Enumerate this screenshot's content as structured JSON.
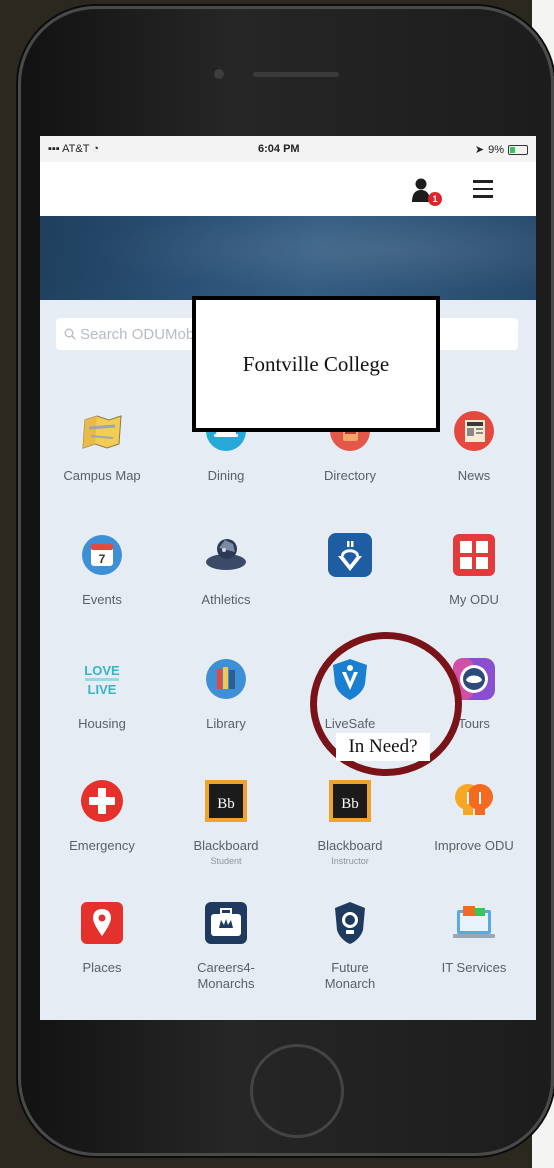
{
  "status_bar": {
    "carrier": "AT&T",
    "time": "6:04 PM",
    "battery": "9%"
  },
  "header": {
    "notification_count": "1",
    "college_name": "Fontville College"
  },
  "search": {
    "placeholder": "Search ODUMobile"
  },
  "grid": [
    {
      "label": "Campus Map",
      "icon": "map-icon"
    },
    {
      "label": "Dining",
      "icon": "dining-icon"
    },
    {
      "label": "Directory",
      "icon": "directory-icon"
    },
    {
      "label": "News",
      "icon": "news-icon"
    },
    {
      "label": "Events",
      "icon": "calendar-icon",
      "day": "7"
    },
    {
      "label": "Athletics",
      "icon": "athletics-icon"
    },
    {
      "label": "In Need?",
      "icon": "in-need-icon"
    },
    {
      "label": "My ODU",
      "icon": "my-odu-icon"
    },
    {
      "label": "Housing",
      "icon": "housing-icon",
      "art_text_top": "LOVE",
      "art_text_bottom": "LIVE"
    },
    {
      "label": "Library",
      "icon": "library-icon"
    },
    {
      "label": "LiveSafe",
      "icon": "livesafe-icon"
    },
    {
      "label": "Tours",
      "icon": "tours-icon"
    },
    {
      "label": "Emergency",
      "icon": "emergency-icon"
    },
    {
      "label": "Blackboard",
      "sublabel": "Student",
      "icon": "blackboard-icon",
      "mark": "Bb"
    },
    {
      "label": "Blackboard",
      "sublabel": "Instructor",
      "icon": "blackboard-icon",
      "mark": "Bb"
    },
    {
      "label": "Improve ODU",
      "icon": "lightbulb-icon"
    },
    {
      "label": "Places",
      "icon": "location-pin-icon"
    },
    {
      "label": "Careers4-\nMonarchs",
      "icon": "briefcase-icon"
    },
    {
      "label": "Future\nMonarch",
      "icon": "future-monarch-icon"
    },
    {
      "label": "IT Services",
      "icon": "it-services-icon"
    }
  ],
  "colors": {
    "banner": "#2c5378",
    "highlight_ring": "#7a1318",
    "dining": "#27a9d8",
    "emergency": "#e4312b"
  }
}
